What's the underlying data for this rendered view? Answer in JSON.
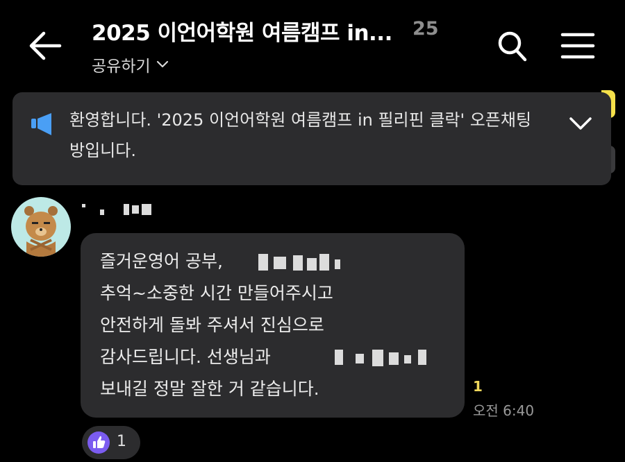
{
  "header": {
    "title": "2025 이언어학원 여름캠프 in...",
    "member_count": "25",
    "share_label": "공유하기",
    "back_icon": "back-arrow-icon",
    "search_icon": "search-icon",
    "menu_icon": "hamburger-menu-icon"
  },
  "notice": {
    "icon": "megaphone-icon",
    "text": "환영합니다. '2025 이언어학원 여름캠프 in 필리핀 클락' 오픈채팅방입니다.",
    "toggle_icon": "chevron-down-icon"
  },
  "message": {
    "avatar": "bear-character-avatar",
    "sender_name": "",
    "text": "즐거운영어 공부, \n추억~소중한 시간 만들어주시고\n안전하게 돌봐 주셔서 진심으로\n감사드립니다.  선생님과 \n보내길 정말 잘한 거 같습니다.",
    "unread_count": "1",
    "time": "오전 6:40",
    "reaction": {
      "icon": "thumbs-up-icon",
      "count": "1"
    }
  },
  "colors": {
    "background": "#000000",
    "bubble": "#2c2c2e",
    "unread": "#f0d85c",
    "reaction": "#7b5cf0",
    "notice_accent": "#4a9ff5"
  }
}
